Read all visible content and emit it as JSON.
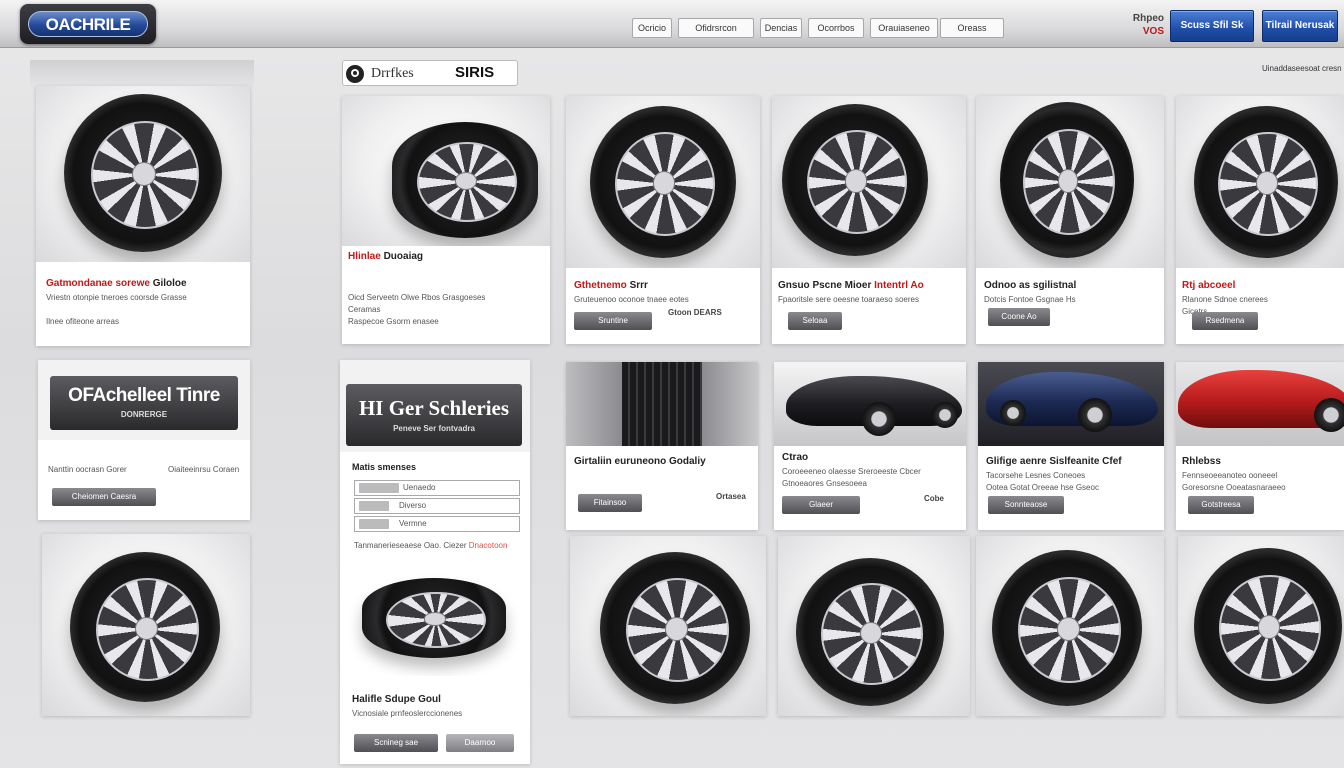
{
  "header": {
    "logo_text": "OACHRILE",
    "nav": [
      "Ocricio",
      "Ofidrsrcon",
      "Dencias",
      "Ocorrbos",
      "Orauiaseneo",
      "Oreass"
    ],
    "cart_line1": "Rhpeo",
    "cart_line2": "VOS",
    "btn_primary": "Scuss Sfil Sk",
    "btn_secondary": "Tilrail Nerusak"
  },
  "search": {
    "label": "Drrfkes",
    "brand": "SIRIS",
    "right_text": "Uinaddaseesoat cresn"
  },
  "left_column": {
    "card_title": "Gatmondanae sorewe",
    "card_title_accent": "Giloloe",
    "card_desc1": "Vriestn otonpie tneroes coorsde Grasse",
    "card_desc2": "Ilnee ofiteone arreas",
    "brand_banner_title": "OFAchelleel Tinre",
    "brand_banner_sub": "DONRERGE",
    "brand_desc1": "Nanttin oocrasn Gorer",
    "brand_desc2": "Oiaiteeinrsu Coraen",
    "brand_btn": "Cheiomen Caesra"
  },
  "center_column": {
    "promo_title": "Hlinlae",
    "promo_title2": "Duoaiag",
    "promo_desc1": "Oicd Serveetn Olwe Rbos Grasgoeses",
    "promo_desc2": "Ceramas",
    "promo_desc3": "Raspecoe Gsorm enasee",
    "series_banner": "HI Ger Schleries",
    "series_sub": "Peneve Ser fontvadra",
    "filter_label": "Matis smenses",
    "field1": "Uenaedo",
    "field2": "Diverso",
    "field3": "Vermne",
    "filter_note": "Tanmanerieseaese Oao. Ciezer",
    "filter_note_accent": "Dnacotoon",
    "bottom_title": "Halifle Sdupe Goul",
    "bottom_desc": "Vicnosiale prnfeoslerccionenes",
    "bottom_btn1": "Scnineg sae",
    "bottom_btn2": "Daarnoo"
  },
  "products": [
    {
      "title": "Gthetnemo",
      "title_accent": "Srrr",
      "desc1": "Gruteuenoo oconoe tnaee eotes",
      "desc2": "",
      "btn": "Sruntine",
      "price": "Gtoon DEARS"
    },
    {
      "title": "Gnsuo Pscne Mioer",
      "title_accent": "Intentrl Ao",
      "desc1": "Fpaoritsle sere oeesne toaraeso soeres",
      "desc2": "",
      "btn": "Seloaa",
      "price": ""
    },
    {
      "title": "Odnoo as sgilistnal",
      "title_accent": "",
      "desc1": "Dotcis Fontoe Gsgnae Hs",
      "desc2": "",
      "btn": "Coone Ao",
      "price": ""
    },
    {
      "title": "Rtj abcoeel",
      "title_accent": "",
      "desc1": "Rlanone Sdnoe cnerees",
      "desc2": "Gicetrs",
      "btn": "Rsedmena",
      "price": ""
    }
  ],
  "promos": [
    {
      "title": "Girtaliin euruneono Godaliy",
      "desc1": "",
      "btn": "Fitainsoo",
      "price": "Ortasea"
    },
    {
      "title": "Ctrao",
      "desc1": "Coroeeeneo olaesse Sreroeeste Cbcer",
      "desc2": "Gtnoeaores Gnsesoeea",
      "btn": "Glaeer",
      "price": "Cobe"
    },
    {
      "title": "Glifige aenre Sislfeanite Cfef",
      "desc1": "Tacorsehe Lesnes Coneoes",
      "desc2": "Ootea Gotat Oreeae hse Gseoc",
      "btn": "Sonnteaose",
      "price": ""
    },
    {
      "title": "Rhlebss",
      "desc1": "Fennseoeeanoteo ooneeel",
      "desc2": "Goresorsne Ooeatasnaraeeo",
      "btn": "Gotstreesa",
      "price": ""
    }
  ]
}
